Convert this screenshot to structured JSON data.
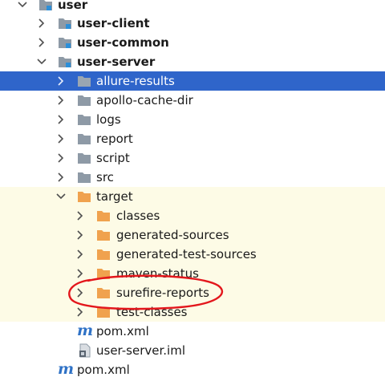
{
  "tree": {
    "items": [
      {
        "label": "user",
        "bold": true,
        "icon": "module-folder-icon",
        "expanded": true
      },
      {
        "label": "user-client",
        "bold": true,
        "icon": "module-folder-icon",
        "expanded": false
      },
      {
        "label": "user-common",
        "bold": true,
        "icon": "module-folder-icon",
        "expanded": false
      },
      {
        "label": "user-server",
        "bold": true,
        "icon": "module-folder-icon",
        "expanded": true
      },
      {
        "label": "allure-results",
        "icon": "folder-icon",
        "expanded": false,
        "selected": true
      },
      {
        "label": "apollo-cache-dir",
        "icon": "folder-icon",
        "expanded": false
      },
      {
        "label": "logs",
        "icon": "folder-icon",
        "expanded": false
      },
      {
        "label": "report",
        "icon": "folder-icon",
        "expanded": false
      },
      {
        "label": "script",
        "icon": "folder-icon",
        "expanded": false
      },
      {
        "label": "src",
        "icon": "folder-icon",
        "expanded": false
      },
      {
        "label": "target",
        "icon": "excluded-folder-icon",
        "expanded": true
      },
      {
        "label": "classes",
        "icon": "excluded-folder-icon",
        "expanded": false
      },
      {
        "label": "generated-sources",
        "icon": "excluded-folder-icon",
        "expanded": false
      },
      {
        "label": "generated-test-sources",
        "icon": "excluded-folder-icon",
        "expanded": false
      },
      {
        "label": "maven-status",
        "icon": "excluded-folder-icon",
        "expanded": false
      },
      {
        "label": "surefire-reports",
        "icon": "excluded-folder-icon",
        "expanded": false
      },
      {
        "label": "test-classes",
        "icon": "excluded-folder-icon",
        "expanded": false
      },
      {
        "label": "pom.xml",
        "icon": "maven-icon"
      },
      {
        "label": "user-server.iml",
        "icon": "iml-file-icon"
      },
      {
        "label": "pom.xml",
        "icon": "maven-icon"
      }
    ],
    "maven_glyph": "m",
    "annotation_icon": "red-circle-annotation-icon"
  },
  "colors": {
    "selection": "#2f65ca",
    "excluded_background": "#fdfbe6",
    "folder_gray": "#8e9aa6",
    "folder_orange": "#f0a24e",
    "maven_blue": "#2f72c6",
    "annotation_red": "#e3161c"
  }
}
